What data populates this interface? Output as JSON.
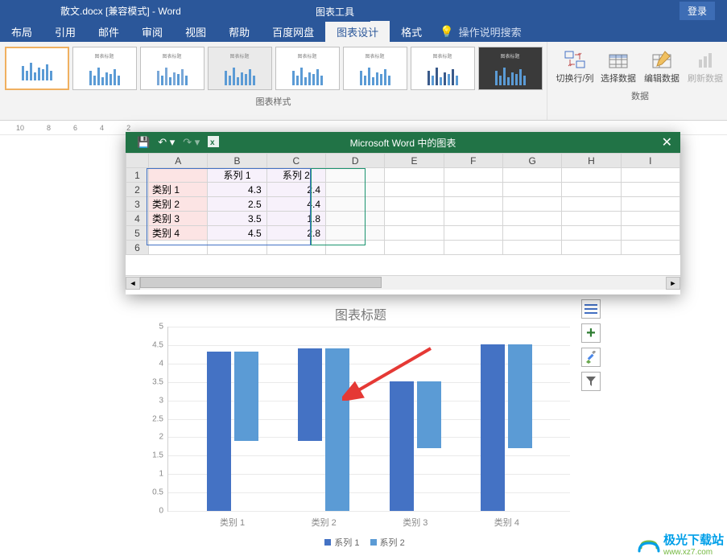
{
  "titlebar": {
    "doc_title": "散文.docx [兼容模式] - Word",
    "tools_tab": "图表工具",
    "login": "登录"
  },
  "ribbon": {
    "tabs": [
      "布局",
      "引用",
      "邮件",
      "审阅",
      "视图",
      "帮助",
      "百度网盘",
      "图表设计",
      "格式"
    ],
    "tell_me": "操作说明搜索",
    "styles_label": "图表样式",
    "data_label": "数据",
    "buttons": {
      "switch": "切换行/列",
      "select": "选择数据",
      "edit": "编辑数据",
      "refresh": "刷新数据"
    }
  },
  "ruler": [
    "10",
    "8",
    "6",
    "4",
    "2"
  ],
  "excel": {
    "title": "Microsoft Word 中的图表",
    "cols": [
      "A",
      "B",
      "C",
      "D",
      "E",
      "F",
      "G",
      "H",
      "I"
    ],
    "headers": {
      "b": "系列 1",
      "c": "系列 2"
    },
    "rows": [
      {
        "n": "1"
      },
      {
        "n": "2",
        "a": "类别 1",
        "b": "4.3",
        "c": "2.4"
      },
      {
        "n": "3",
        "a": "类别 2",
        "b": "2.5",
        "c": "4.4"
      },
      {
        "n": "4",
        "a": "类别 3",
        "b": "3.5",
        "c": "1.8"
      },
      {
        "n": "5",
        "a": "类别 4",
        "b": "4.5",
        "c": "2.8"
      },
      {
        "n": "6"
      }
    ]
  },
  "chart_data": {
    "type": "bar",
    "title": "图表标题",
    "categories": [
      "类别 1",
      "类别 2",
      "类别 3",
      "类别 4"
    ],
    "series": [
      {
        "name": "系列 1",
        "values": [
          4.3,
          2.5,
          3.5,
          4.5
        ],
        "color": "#4472c4"
      },
      {
        "name": "系列 2",
        "values": [
          2.4,
          4.4,
          1.8,
          2.8
        ],
        "color": "#5b9bd5"
      }
    ],
    "ylim": [
      0,
      5
    ],
    "ytick": 0.5
  },
  "side": {
    "layout": "≡",
    "add": "+",
    "style": "brush",
    "filter": "funnel"
  },
  "watermark": {
    "cn": "极光下载站",
    "url": "www.xz7.com"
  }
}
